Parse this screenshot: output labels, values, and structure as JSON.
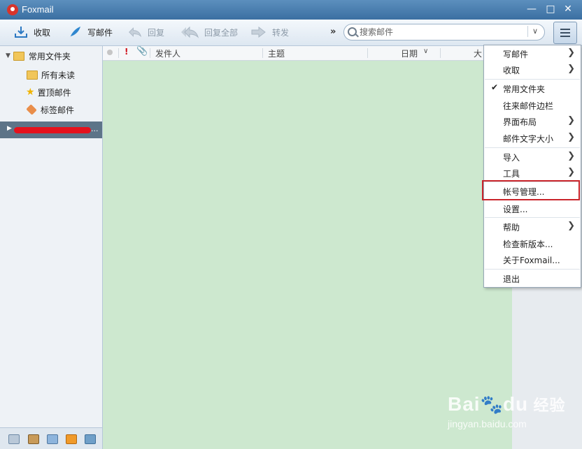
{
  "window": {
    "title": "Foxmail"
  },
  "window_controls": {
    "minimize": "—",
    "maximize": "□",
    "close": "✕"
  },
  "toolbar": {
    "buttons": [
      {
        "label": "收取",
        "icon": "download-icon"
      },
      {
        "label": "写邮件",
        "icon": "feather-pen-icon"
      },
      {
        "label": "回复",
        "icon": "reply-icon"
      },
      {
        "label": "回复全部",
        "icon": "reply-all-icon"
      },
      {
        "label": "转发",
        "icon": "forward-icon"
      }
    ],
    "more": "»",
    "search_placeholder": "搜索邮件",
    "search_options": "»"
  },
  "sidebar": {
    "root": "常用文件夹",
    "items": [
      {
        "label": "所有未读",
        "icon": "folder-icon"
      },
      {
        "label": "置顶邮件",
        "icon": "star-icon"
      },
      {
        "label": "标签邮件",
        "icon": "tag-icon"
      }
    ],
    "account_suffix": "..."
  },
  "list_header": {
    "sender": "发件人",
    "subject": "主题",
    "date": "日期",
    "size": "大"
  },
  "menu": {
    "items": [
      {
        "label": "写邮件",
        "submenu": true,
        "checked": false
      },
      {
        "label": "收取",
        "submenu": true,
        "checked": false
      },
      {
        "label": "常用文件夹",
        "submenu": false,
        "checked": true
      },
      {
        "label": "往来邮件边栏",
        "submenu": false,
        "checked": false
      },
      {
        "label": "界面布局",
        "submenu": true,
        "checked": false
      },
      {
        "label": "邮件文字大小",
        "submenu": true,
        "checked": false
      },
      {
        "label": "导入",
        "submenu": true,
        "checked": false
      },
      {
        "label": "工具",
        "submenu": true,
        "checked": false
      },
      {
        "label": "帐号管理...",
        "submenu": false,
        "checked": false,
        "highlighted": true
      },
      {
        "label": "设置...",
        "submenu": false,
        "checked": false
      },
      {
        "label": "帮助",
        "submenu": true,
        "checked": false
      },
      {
        "label": "检查新版本...",
        "submenu": false,
        "checked": false
      },
      {
        "label": "关于Foxmail...",
        "submenu": false,
        "checked": false
      },
      {
        "label": "退出",
        "submenu": false,
        "checked": false
      }
    ]
  },
  "watermark": {
    "brand": "Bai",
    "brand2": "du",
    "cn": "经验",
    "url": "jingyan.baidu.com"
  },
  "colors": {
    "list_bg": "#cde8cf",
    "highlight_border": "#c9242a",
    "titlebar": "#3b6fa2"
  }
}
